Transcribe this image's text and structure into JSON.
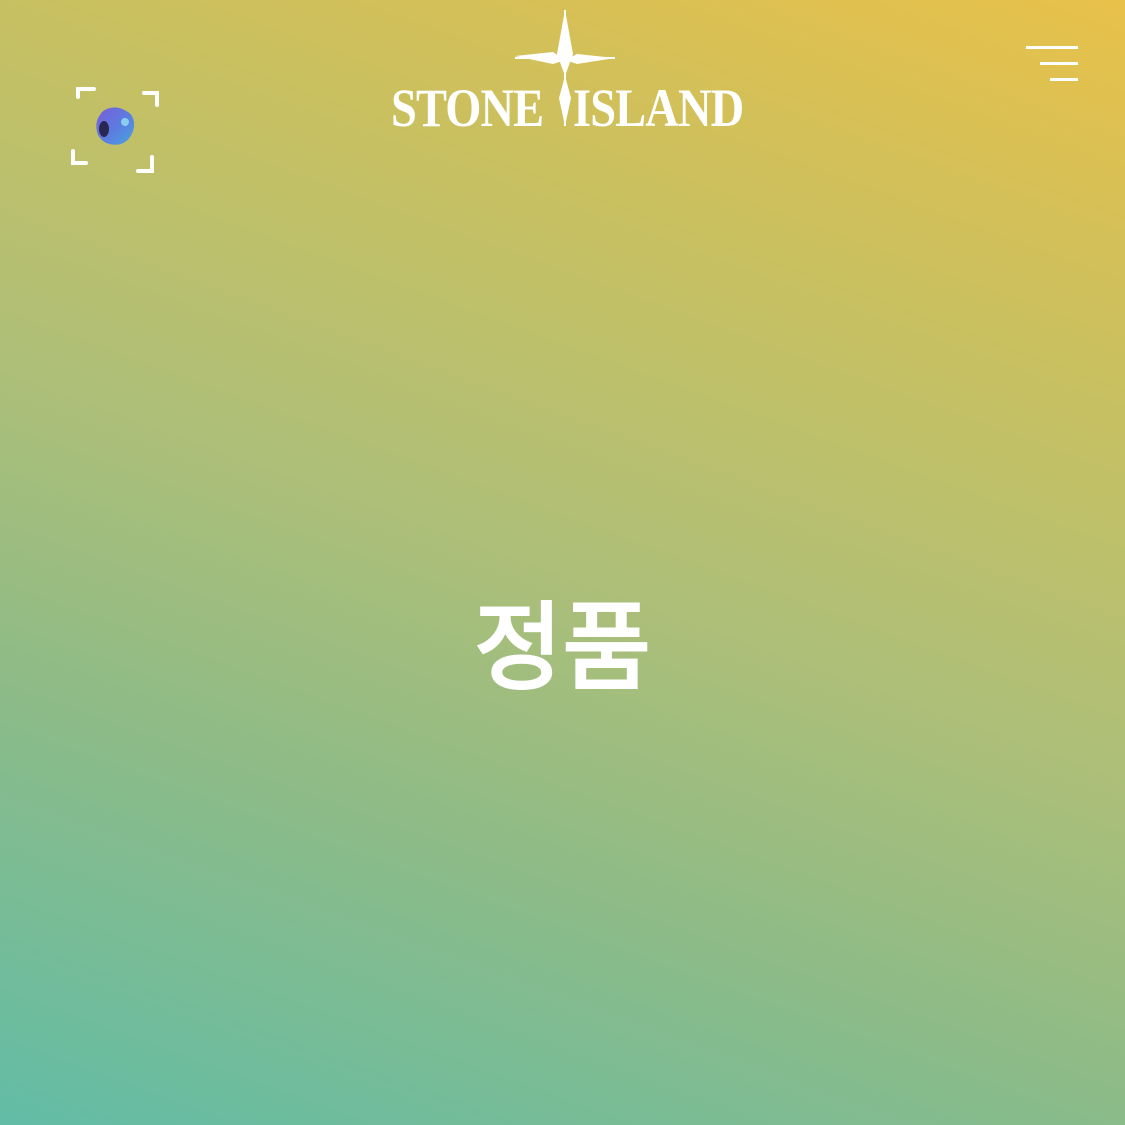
{
  "header": {
    "brand": {
      "left_word": "STONE",
      "right_word": "ISLAND",
      "icon": "compass-rose-icon"
    },
    "ar_button": {
      "icon": "ar-scan-icon"
    },
    "menu_button": {
      "icon": "hamburger-menu-icon"
    }
  },
  "main": {
    "headline": "정품"
  },
  "colors": {
    "gradient_top_right": "#e8c14a",
    "gradient_mid": "#aebf78",
    "gradient_bottom_left": "#62bca6",
    "text": "#ffffff",
    "ar_orb_purple": "#7a5bd9",
    "ar_orb_blue": "#4aa3e0"
  }
}
